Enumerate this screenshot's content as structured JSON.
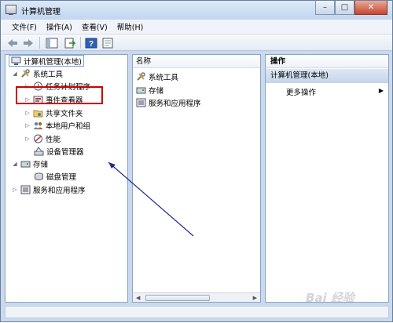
{
  "window": {
    "title": "计算机管理",
    "buttons": {
      "minimize": "–",
      "maximize": "□",
      "close": "✕"
    }
  },
  "menu": [
    "文件(F)",
    "操作(A)",
    "查看(V)",
    "帮助(H)"
  ],
  "tree": {
    "root": "计算机管理(本地)",
    "system_tools": "系统工具",
    "task_scheduler": "任务计划程序",
    "event_viewer": "事件查看器",
    "shared_folders": "共享文件夹",
    "local_users": "本地用户和组",
    "performance": "性能",
    "device_manager": "设备管理器",
    "storage": "存储",
    "disk_management": "磁盘管理",
    "services_apps": "服务和应用程序"
  },
  "list": {
    "header": "名称",
    "items": [
      "系统工具",
      "存储",
      "服务和应用程序"
    ]
  },
  "actions": {
    "header": "操作",
    "section": "计算机管理(本地)",
    "more": "更多操作"
  },
  "watermark": "Bai 经验",
  "colors": {
    "highlight": "#cc0000",
    "annotation_arrow": "#1e2a8a"
  }
}
